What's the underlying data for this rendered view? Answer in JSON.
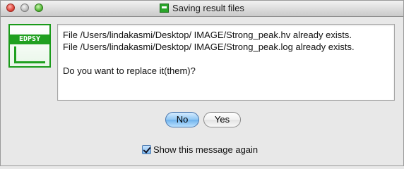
{
  "window": {
    "title": "Saving result files"
  },
  "app_icon": {
    "label": "EDPSY",
    "icon": "edpsy-logo-icon"
  },
  "message": {
    "lines": [
      "File /Users/lindakasmi/Desktop/ IMAGE/Strong_peak.hv already exists.",
      "File /Users/lindakasmi/Desktop/ IMAGE/Strong_peak.log already exists."
    ],
    "question": "Do you want to replace it(them)?"
  },
  "buttons": {
    "no_label": "No",
    "yes_label": "Yes"
  },
  "checkbox": {
    "label": "Show this message again",
    "checked": true
  },
  "colors": {
    "accent": "#20a020",
    "default_button": "#8fc6f3"
  }
}
